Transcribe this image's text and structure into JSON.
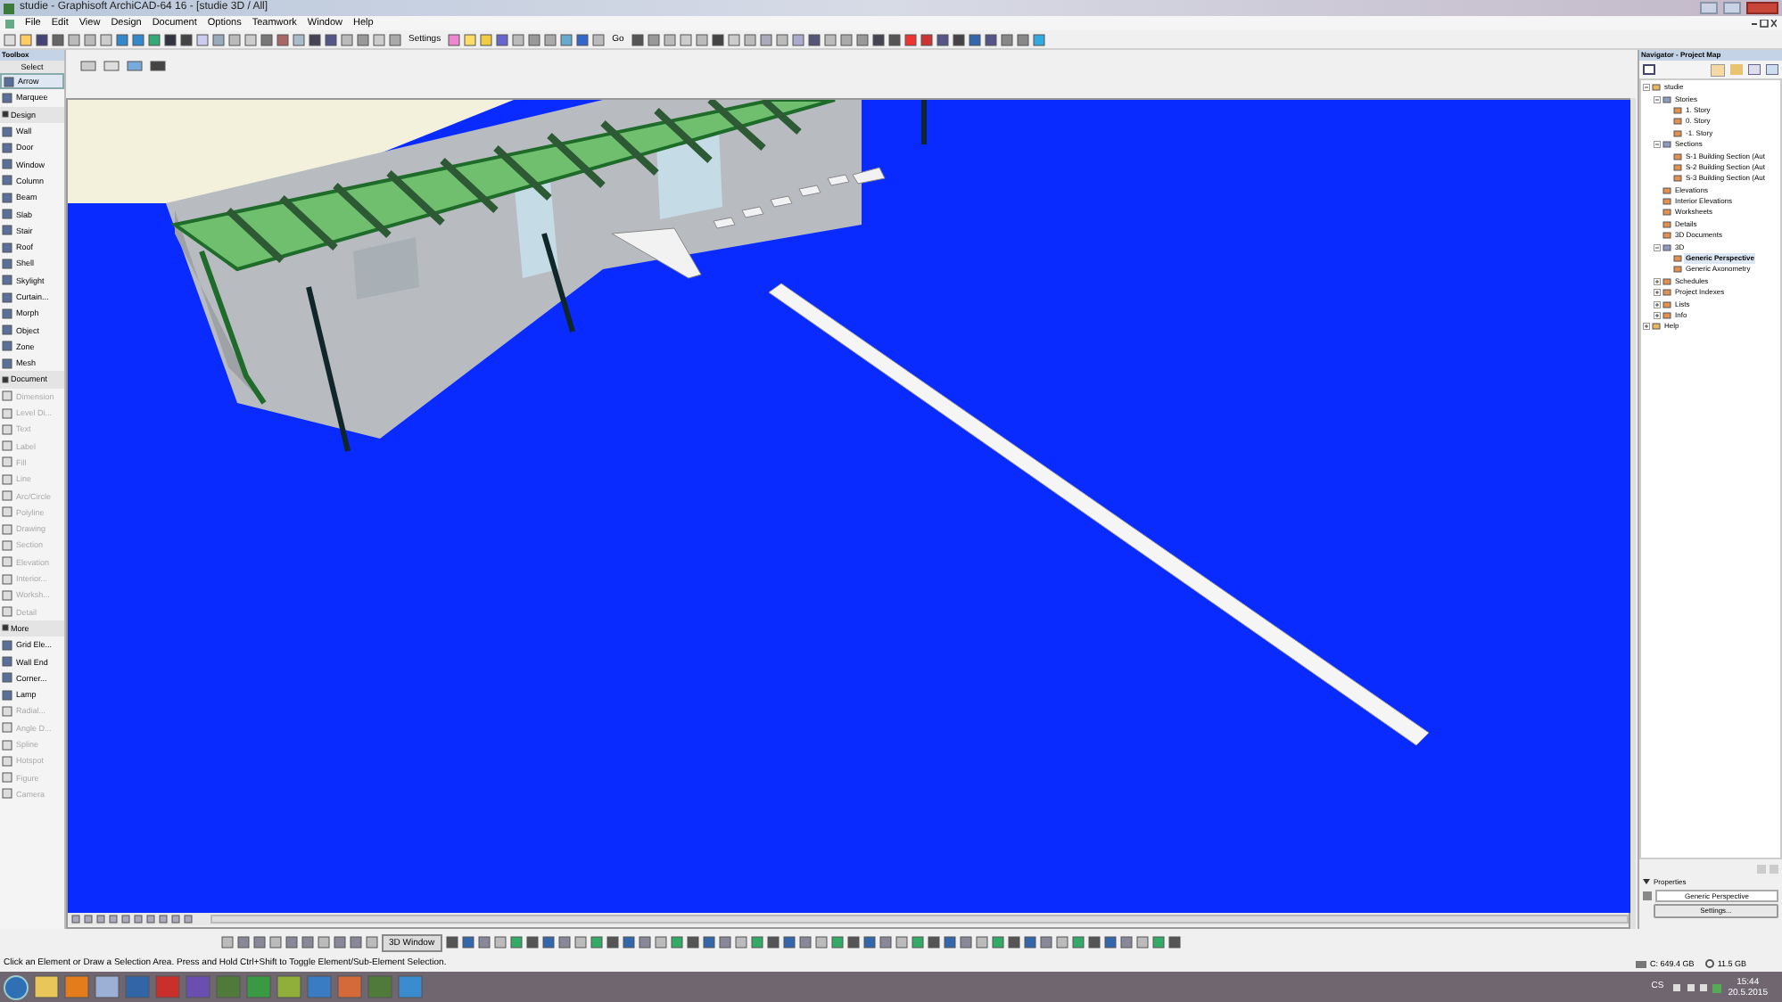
{
  "window": {
    "title": "studie - Graphisoft ArchiCAD-64 16 - [studie 3D / All]"
  },
  "menu": [
    "File",
    "Edit",
    "View",
    "Design",
    "Document",
    "Options",
    "Teamwork",
    "Window",
    "Help"
  ],
  "toolbar": {
    "settings_label": "Settings",
    "go_label": "Go"
  },
  "toolbox": {
    "title": "Toolbox",
    "select_label": "Select",
    "items": [
      {
        "kind": "tool",
        "label": "Arrow",
        "selected": true,
        "disabled": false
      },
      {
        "kind": "tool",
        "label": "Marquee",
        "selected": false,
        "disabled": false
      },
      {
        "kind": "group",
        "label": "Design"
      },
      {
        "kind": "tool",
        "label": "Wall",
        "selected": false,
        "disabled": false
      },
      {
        "kind": "tool",
        "label": "Door",
        "selected": false,
        "disabled": false
      },
      {
        "kind": "tool",
        "label": "Window",
        "selected": false,
        "disabled": false
      },
      {
        "kind": "tool",
        "label": "Column",
        "selected": false,
        "disabled": false
      },
      {
        "kind": "tool",
        "label": "Beam",
        "selected": false,
        "disabled": false
      },
      {
        "kind": "tool",
        "label": "Slab",
        "selected": false,
        "disabled": false
      },
      {
        "kind": "tool",
        "label": "Stair",
        "selected": false,
        "disabled": false
      },
      {
        "kind": "tool",
        "label": "Roof",
        "selected": false,
        "disabled": false
      },
      {
        "kind": "tool",
        "label": "Shell",
        "selected": false,
        "disabled": false
      },
      {
        "kind": "tool",
        "label": "Skylight",
        "selected": false,
        "disabled": false
      },
      {
        "kind": "tool",
        "label": "Curtain...",
        "selected": false,
        "disabled": false
      },
      {
        "kind": "tool",
        "label": "Morph",
        "selected": false,
        "disabled": false
      },
      {
        "kind": "tool",
        "label": "Object",
        "selected": false,
        "disabled": false
      },
      {
        "kind": "tool",
        "label": "Zone",
        "selected": false,
        "disabled": false
      },
      {
        "kind": "tool",
        "label": "Mesh",
        "selected": false,
        "disabled": false
      },
      {
        "kind": "group",
        "label": "Document"
      },
      {
        "kind": "tool",
        "label": "Dimension",
        "selected": false,
        "disabled": true
      },
      {
        "kind": "tool",
        "label": "Level Di...",
        "selected": false,
        "disabled": true
      },
      {
        "kind": "tool",
        "label": "Text",
        "selected": false,
        "disabled": true
      },
      {
        "kind": "tool",
        "label": "Label",
        "selected": false,
        "disabled": true
      },
      {
        "kind": "tool",
        "label": "Fill",
        "selected": false,
        "disabled": true
      },
      {
        "kind": "tool",
        "label": "Line",
        "selected": false,
        "disabled": true
      },
      {
        "kind": "tool",
        "label": "Arc/Circle",
        "selected": false,
        "disabled": true
      },
      {
        "kind": "tool",
        "label": "Polyline",
        "selected": false,
        "disabled": true
      },
      {
        "kind": "tool",
        "label": "Drawing",
        "selected": false,
        "disabled": true
      },
      {
        "kind": "tool",
        "label": "Section",
        "selected": false,
        "disabled": true
      },
      {
        "kind": "tool",
        "label": "Elevation",
        "selected": false,
        "disabled": true
      },
      {
        "kind": "tool",
        "label": "Interior...",
        "selected": false,
        "disabled": true
      },
      {
        "kind": "tool",
        "label": "Worksh...",
        "selected": false,
        "disabled": true
      },
      {
        "kind": "tool",
        "label": "Detail",
        "selected": false,
        "disabled": true
      },
      {
        "kind": "group",
        "label": "More"
      },
      {
        "kind": "tool",
        "label": "Grid Ele...",
        "selected": false,
        "disabled": false
      },
      {
        "kind": "tool",
        "label": "Wall End",
        "selected": false,
        "disabled": false
      },
      {
        "kind": "tool",
        "label": "Corner...",
        "selected": false,
        "disabled": false
      },
      {
        "kind": "tool",
        "label": "Lamp",
        "selected": false,
        "disabled": false
      },
      {
        "kind": "tool",
        "label": "Radial...",
        "selected": false,
        "disabled": true
      },
      {
        "kind": "tool",
        "label": "Angle D...",
        "selected": false,
        "disabled": true
      },
      {
        "kind": "tool",
        "label": "Spline",
        "selected": false,
        "disabled": true
      },
      {
        "kind": "tool",
        "label": "Hotspot",
        "selected": false,
        "disabled": true
      },
      {
        "kind": "tool",
        "label": "Figure",
        "selected": false,
        "disabled": true
      },
      {
        "kind": "tool",
        "label": "Camera",
        "selected": false,
        "disabled": true
      }
    ]
  },
  "navigator": {
    "title": "Navigator - Project Map",
    "tree": [
      {
        "label": "studie",
        "expanded": true,
        "selected": false,
        "children": [
          {
            "label": "Stories",
            "expanded": true,
            "selected": false,
            "children": [
              {
                "label": "1. Story",
                "selected": false
              },
              {
                "label": "0. Story",
                "selected": false
              },
              {
                "label": "-1. Story",
                "selected": false
              }
            ]
          },
          {
            "label": "Sections",
            "expanded": true,
            "selected": false,
            "children": [
              {
                "label": "S-1 Building Section (Aut",
                "selected": false
              },
              {
                "label": "S-2 Building Section (Aut",
                "selected": false
              },
              {
                "label": "S-3 Building Section (Aut",
                "selected": false
              }
            ]
          },
          {
            "label": "Elevations",
            "selected": false
          },
          {
            "label": "Interior Elevations",
            "selected": false
          },
          {
            "label": "Worksheets",
            "selected": false
          },
          {
            "label": "Details",
            "selected": false
          },
          {
            "label": "3D Documents",
            "selected": false
          },
          {
            "label": "3D",
            "expanded": true,
            "selected": false,
            "children": [
              {
                "label": "Generic Perspective",
                "selected": true
              },
              {
                "label": "Generic Axonometry",
                "selected": false
              }
            ]
          },
          {
            "label": "Schedules",
            "expanded": false,
            "selected": false
          },
          {
            "label": "Project Indexes",
            "expanded": false,
            "selected": false
          },
          {
            "label": "Lists",
            "expanded": false,
            "selected": false
          },
          {
            "label": "Info",
            "expanded": false,
            "selected": false
          }
        ]
      },
      {
        "label": "Help",
        "expanded": false,
        "selected": false
      }
    ],
    "properties": {
      "title": "Properties",
      "view_name": "Generic Perspective",
      "button": "Settings..."
    }
  },
  "bottom_toolbar": {
    "window_button": "3D Window"
  },
  "status_bar": {
    "message": "Click an Element or Draw a Selection Area. Press and Hold Ctrl+Shift to Toggle Element/Sub-Element Selection.",
    "disk": "C: 649.4 GB",
    "memory": "11.5 GB"
  },
  "taskbar": {
    "language": "CS",
    "time": "15:44",
    "date": "20.5.2015"
  }
}
